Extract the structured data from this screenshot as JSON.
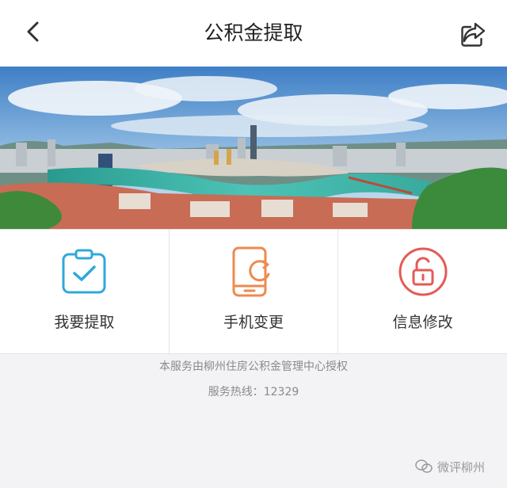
{
  "header": {
    "title": "公积金提取",
    "back_icon": "chevron-left-icon",
    "share_icon": "share-icon"
  },
  "banner": {
    "description_icon": "city-river-photo"
  },
  "tiles": [
    {
      "label": "我要提取",
      "icon": "clipboard-check-icon",
      "color": "#2fa8dc"
    },
    {
      "label": "手机变更",
      "icon": "phone-refresh-icon",
      "color": "#ee8a4f"
    },
    {
      "label": "信息修改",
      "icon": "unlock-icon",
      "color": "#e45a55"
    }
  ],
  "footer": {
    "authorization": "本服务由柳州住房公积金管理中心授权",
    "hotline": "服务热线：12329"
  },
  "watermark": {
    "text": "微评柳州"
  }
}
